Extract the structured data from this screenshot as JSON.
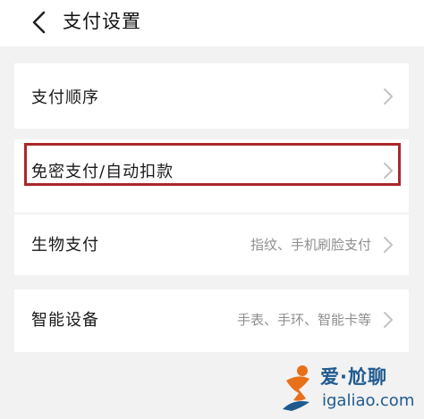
{
  "header": {
    "title": "支付设置",
    "back_icon": "chevron-left-icon"
  },
  "settings": [
    {
      "label": "支付顺序",
      "value": ""
    },
    {
      "label": "免密支付/自动扣款",
      "value": ""
    },
    {
      "label": "生物支付",
      "value": "指纹、手机刷脸支付"
    },
    {
      "label": "智能设备",
      "value": "手表、手环、智能卡等"
    }
  ],
  "watermark": {
    "brand": "爱·尬聊",
    "url": "igaliao.com"
  },
  "colors": {
    "background": "#f2f2f2",
    "card": "#ffffff",
    "highlight_border": "#a8282a",
    "secondary_text": "#8f8f8f",
    "watermark_blue": "#1f5a8f",
    "watermark_orange": "#e8701a"
  }
}
